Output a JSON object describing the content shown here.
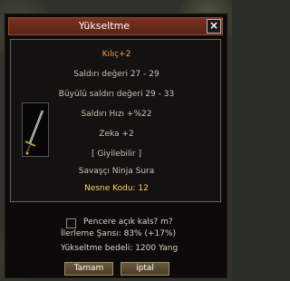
{
  "window": {
    "title": "Yükseltme"
  },
  "item": {
    "name": "Kılıç+2",
    "stats": [
      "Saldırı değeri 27 - 29",
      "Büyülü saldırı değeri 29 - 33",
      "Saldırı Hızı +%22",
      "Zeka +2"
    ],
    "wearable": "[ Giyilebilir ]",
    "classes": "Savaşçı Ninja Sura",
    "code": "Nesne Kodu: 12"
  },
  "option": {
    "label": "Pencere açık kals? m?",
    "checked": false
  },
  "info": {
    "chance": "İlerleme Şansı: 83% (+17%)",
    "cost": "Yükseltme bedeli: 1200 Yang"
  },
  "buttons": {
    "ok": "Tamam",
    "cancel": "iptal"
  },
  "colors": {
    "title_bar": "#6a2a1a",
    "item_name": "#ff9a48",
    "item_code": "#ffd070"
  },
  "icons": {
    "close": "close-icon",
    "item": "sword-icon"
  }
}
